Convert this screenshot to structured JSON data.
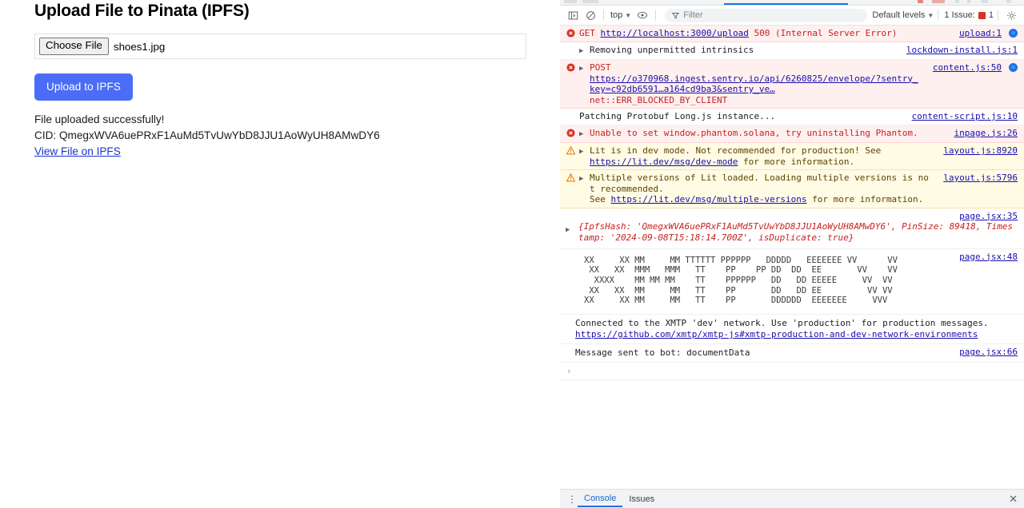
{
  "page": {
    "title": "Upload File to Pinata (IPFS)",
    "choose_file_label": "Choose File",
    "file_name": "shoes1.jpg",
    "upload_button_label": "Upload to IPFS",
    "status_message": "File uploaded successfully!",
    "cid_line": "CID: QmegxWVA6uePRxF1AuMd5TvUwYbD8JJU1AoWyUH8AMwDY6",
    "view_link_label": "View File on IPFS",
    "accent_color": "#4a6cf7",
    "link_color": "#1a34c8"
  },
  "devtools": {
    "toolbar": {
      "sidebar_icon": "panel-toggle-icon",
      "clear_icon": "clear-console-icon",
      "context_selector": "top",
      "eye_icon": "live-expression-icon",
      "filter_icon": "filter-icon",
      "filter_placeholder": "Filter",
      "filter_value": "",
      "levels_label": "Default levels",
      "issues_label": "1 Issue:",
      "issues_count": "1",
      "settings_icon": "gear-icon"
    },
    "messages": [
      {
        "severity": "error",
        "kind": "network",
        "text_parts": [
          {
            "t": "GET ",
            "link": false
          },
          {
            "t": "http://localhost:3000/upload",
            "link": true
          },
          {
            "t": " 500 (Internal Server Error)",
            "link": false
          }
        ],
        "source": "upload:1",
        "has_net_badge": true,
        "expandable": false
      },
      {
        "severity": "none",
        "kind": "log",
        "text_parts": [
          {
            "t": "Removing unpermitted intrinsics",
            "link": false
          }
        ],
        "source": "lockdown-install.js:1",
        "has_net_badge": false,
        "expandable": true
      },
      {
        "severity": "error",
        "kind": "network",
        "text_parts": [
          {
            "t": "POST\n",
            "link": false
          },
          {
            "t": "https://o370968.ingest.sentry.io/api/6260825/envelope/?sentry_key=c92db6591…a164cd9ba3&sentry_ve…",
            "link": true
          },
          {
            "t": "\nnet::ERR_BLOCKED_BY_CLIENT",
            "link": false
          }
        ],
        "source": "content.js:50",
        "has_net_badge": true,
        "expandable": true
      },
      {
        "severity": "none",
        "kind": "log",
        "text_parts": [
          {
            "t": "Patching Protobuf Long.js instance...",
            "link": false
          }
        ],
        "source": "content-script.js:10",
        "has_net_badge": false,
        "expandable": false
      },
      {
        "severity": "error",
        "kind": "log",
        "text_parts": [
          {
            "t": "Unable to set window.phantom.solana, try uninstalling Phantom.",
            "link": false
          }
        ],
        "source": "inpage.js:26",
        "has_net_badge": false,
        "expandable": true
      },
      {
        "severity": "warning",
        "kind": "log",
        "text_parts": [
          {
            "t": "Lit is in dev mode. Not recommended for production! See\n",
            "link": false
          },
          {
            "t": "https://lit.dev/msg/dev-mode",
            "link": true
          },
          {
            "t": " for more information.",
            "link": false
          }
        ],
        "source": "layout.js:8920",
        "has_net_badge": false,
        "expandable": true
      },
      {
        "severity": "warning",
        "kind": "log",
        "text_parts": [
          {
            "t": "Multiple versions of Lit loaded. Loading multiple versions is not recommended.\nSee ",
            "link": false
          },
          {
            "t": "https://lit.dev/msg/multiple-versions",
            "link": true
          },
          {
            "t": " for more information.",
            "link": false
          }
        ],
        "source": "layout.js:5796",
        "has_net_badge": false,
        "expandable": true
      }
    ],
    "object_log": {
      "source": "page.jsx:35",
      "text": "{IpfsHash: 'QmegxWVA6uePRxF1AuMd5TvUwYbD8JJU1AoWyUH8AMwDY6', PinSize: 89418, Timestamp: '2024-09-08T15:18:14.700Z', isDuplicate: true}",
      "expandable": true
    },
    "ascii_log": {
      "source": "page.jsx:48",
      "art": "XX     XX MM     MM TTTTTT PPPPPP   DDDDD   EEEEEEE VV      VV\n XX   XX  MMM   MMM   TT    PP    PP DD  DD  EE       VV    VV\n  XXXX    MM MM MM    TT    PPPPPP   DD   DD EEEEE     VV  VV\n XX   XX  MM     MM   TT    PP       DD   DD EE         VV VV\nXX     XX MM     MM   TT    PP       DDDDDD  EEEEEEE     VVV"
    },
    "xmtp_notice": {
      "line1": "Connected to the XMTP 'dev' network. Use 'production' for production messages.",
      "link": "https://github.com/xmtp/xmtp-js#xmtp-production-and-dev-network-environments"
    },
    "bot_message": {
      "text": "Message sent to bot: documentData",
      "source": "page.jsx:66"
    },
    "prompt_caret": "›",
    "drawer": {
      "kebab_icon": "more-options-icon",
      "tabs": [
        {
          "label": "Console",
          "active": true
        },
        {
          "label": "Issues",
          "active": false
        }
      ],
      "close_icon": "close-icon",
      "close_glyph": "✕"
    }
  }
}
